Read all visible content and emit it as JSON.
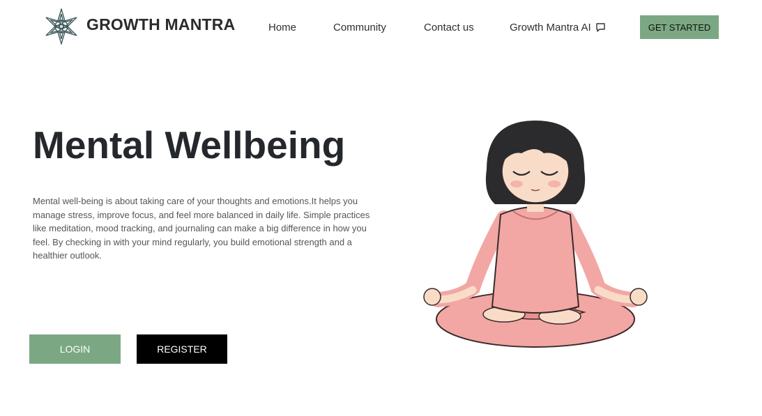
{
  "brand": {
    "name": "GROWTH MANTRA",
    "logo_icon": "mandala-icon"
  },
  "nav": {
    "items": [
      {
        "label": "Home"
      },
      {
        "label": "Community"
      },
      {
        "label": "Contact us"
      },
      {
        "label": "Growth Mantra AI",
        "icon": "chat-bubble-icon"
      }
    ],
    "cta_label": "GET STARTED"
  },
  "hero": {
    "title": "Mental Wellbeing",
    "description": "Mental well-being is about taking care of your thoughts and emotions.It helps you manage stress, improve focus, and feel more balanced in daily life. Simple practices like meditation, mood tracking, and journaling can make a big difference in how you feel. By checking in with your mind regularly, you build emotional strength and a healthier outlook.",
    "login_label": "LOGIN",
    "register_label": "REGISTER",
    "illustration": "meditating-girl-illustration"
  },
  "colors": {
    "accent": "#7ba883",
    "dark": "#000000",
    "text": "#24282c",
    "skin": "#f9dcc8",
    "shirt": "#f2a7a4",
    "hair": "#2b2b2d"
  }
}
